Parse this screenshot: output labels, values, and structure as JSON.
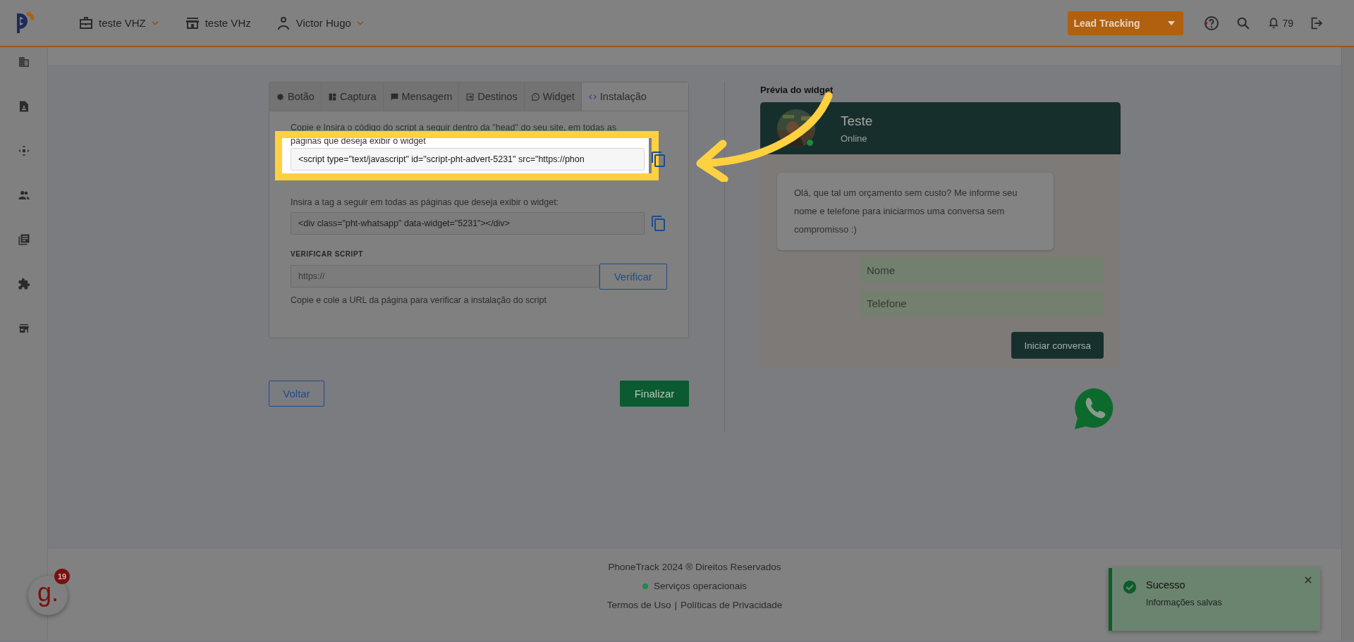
{
  "topbar": {
    "workspace": "teste VHZ",
    "store": "teste VHz",
    "user": "Victor Hugo",
    "product_menu": "Lead Tracking",
    "notifications": "79"
  },
  "tabs": [
    {
      "label": "Botão",
      "selected": false
    },
    {
      "label": "Captura",
      "selected": false
    },
    {
      "label": "Mensagem",
      "selected": false
    },
    {
      "label": "Destinos",
      "selected": false
    },
    {
      "label": "Widget",
      "selected": false
    },
    {
      "label": "Instalação",
      "selected": true
    }
  ],
  "install": {
    "script_hint": "Copie e Insira o código do script a seguir dentro da \"head\" do seu site, em todas as páginas que deseja exibir o widget",
    "script_code": "<script type=\"text/javascript\" id=\"script-pht-advert-5231\" src=\"https://phon",
    "tag_hint": "Insira a tag a seguir em todas as páginas que deseja exibir o widget:",
    "tag_code": "<div class=\"pht-whatsapp\" data-widget=\"5231\"></div>",
    "verify_title": "VERIFICAR SCRIPT",
    "verify_placeholder": "https://",
    "verify_button": "Verificar",
    "verify_help": "Copie e cole a URL da página para verificar a instalação do script"
  },
  "actions": {
    "back": "Voltar",
    "finish": "Finalizar"
  },
  "preview": {
    "title": "Prévia do widget",
    "name": "Teste",
    "status": "Online",
    "online": true,
    "message": "Olá, que tal um orçamento sem custo? Me informe seu nome e telefone para iniciarmos uma conversa sem compromisso :)",
    "fields": [
      {
        "placeholder": "Nome"
      },
      {
        "placeholder": "Telefone"
      }
    ],
    "button": "Iniciar conversa"
  },
  "footer": {
    "copyright": "PhoneTrack 2024 ® Direitos Reservados",
    "status": "Serviços operacionais",
    "links": [
      "Termos de Uso",
      "Políticas de Privacidade"
    ],
    "separator": "|"
  },
  "toast": {
    "title": "Sucesso",
    "message": "Informações salvas"
  },
  "chat_badge": {
    "logo": "g.",
    "count": "19"
  }
}
